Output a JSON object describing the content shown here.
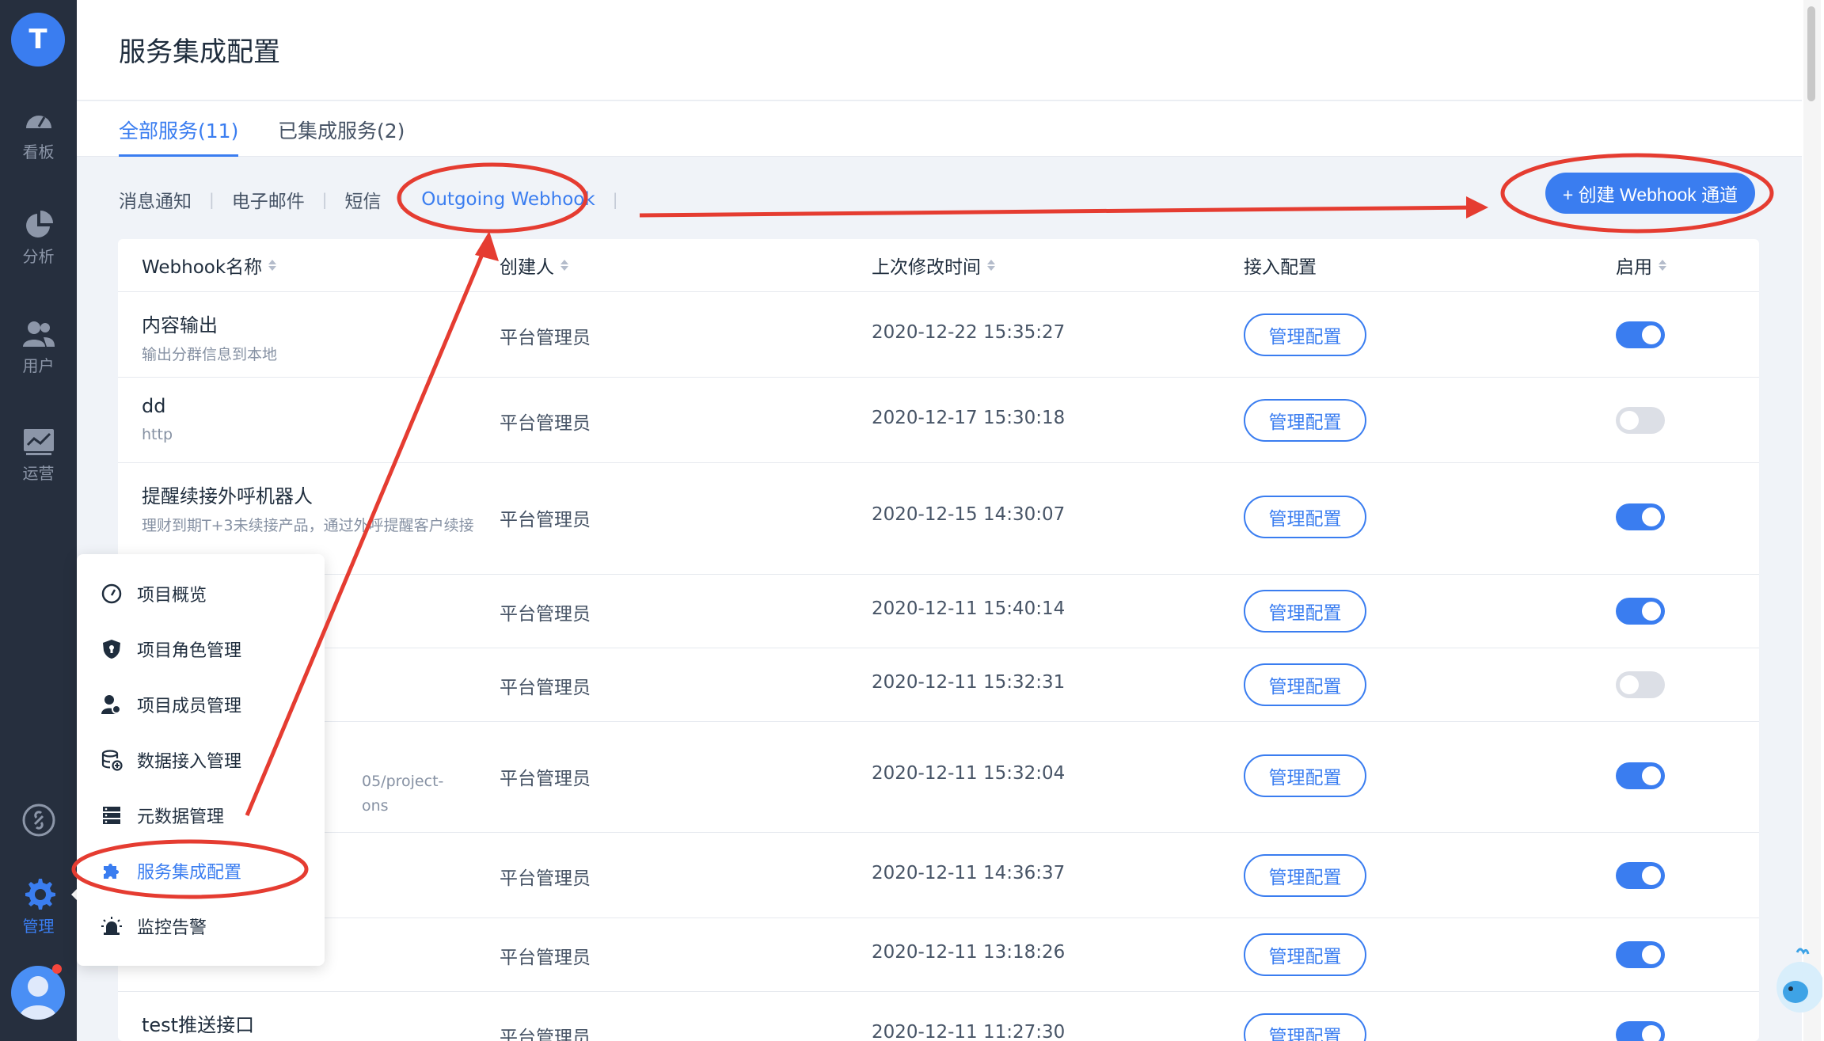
{
  "rail": {
    "avatar_letter": "T",
    "items": [
      {
        "label": "看板",
        "icon": "gauge-icon"
      },
      {
        "label": "分析",
        "icon": "pie-chart-icon"
      },
      {
        "label": "用户",
        "icon": "users-icon"
      },
      {
        "label": "运营",
        "icon": "trend-chart-icon"
      },
      {
        "label": "管理",
        "icon": "gear-icon"
      }
    ]
  },
  "header": {
    "title": "服务集成配置"
  },
  "tabs": [
    {
      "label": "全部服务(11)",
      "active": true
    },
    {
      "label": "已集成服务(2)",
      "active": false
    }
  ],
  "filters": [
    {
      "label": "消息通知"
    },
    {
      "label": "电子邮件"
    },
    {
      "label": "短信"
    },
    {
      "label": "Outgoing Webhook",
      "active": true
    }
  ],
  "create_button": "+ 创建 Webhook 通道",
  "table": {
    "columns": [
      "Webhook名称",
      "创建人",
      "上次修改时间",
      "接入配置",
      "启用"
    ],
    "manage_label": "管理配置",
    "rows": [
      {
        "name": "内容输出",
        "desc": "输出分群信息到本地",
        "creator": "平台管理员",
        "time": "2020-12-22 15:35:27",
        "enabled": true
      },
      {
        "name": "dd",
        "desc": "http",
        "creator": "平台管理员",
        "time": "2020-12-17 15:30:18",
        "enabled": false
      },
      {
        "name": "提醒续接外呼机器人",
        "desc": "理财到期T+3未续接产品，通过外呼提醒客户续接",
        "creator": "平台管理员",
        "time": "2020-12-15 14:30:07",
        "enabled": true
      },
      {
        "name": "",
        "desc": "",
        "creator": "平台管理员",
        "time": "2020-12-11 15:40:14",
        "enabled": true
      },
      {
        "name": "",
        "desc": "",
        "creator": "平台管理员",
        "time": "2020-12-11 15:32:31",
        "enabled": false
      },
      {
        "name": "",
        "desc": "05/project-",
        "desc2": "ons",
        "creator": "平台管理员",
        "time": "2020-12-11 15:32:04",
        "enabled": true
      },
      {
        "name": "",
        "desc": "",
        "creator": "平台管理员",
        "time": "2020-12-11 14:36:37",
        "enabled": true
      },
      {
        "name": "",
        "desc": "",
        "creator": "平台管理员",
        "time": "2020-12-11 13:18:26",
        "enabled": true
      },
      {
        "name": "test推送接口",
        "desc": "",
        "creator": "平台管理员",
        "time": "2020-12-11 11:27:30",
        "enabled": true
      }
    ]
  },
  "menu": {
    "items": [
      {
        "label": "项目概览",
        "icon": "dashboard-icon"
      },
      {
        "label": "项目角色管理",
        "icon": "shield-icon"
      },
      {
        "label": "项目成员管理",
        "icon": "member-icon"
      },
      {
        "label": "数据接入管理",
        "icon": "database-add-icon"
      },
      {
        "label": "元数据管理",
        "icon": "server-icon"
      },
      {
        "label": "服务集成配置",
        "icon": "puzzle-icon",
        "active": true
      },
      {
        "label": "监控告警",
        "icon": "alarm-icon"
      }
    ]
  },
  "colors": {
    "accent": "#3a7df0",
    "rail": "#262f3e",
    "annotation": "#e53c31"
  }
}
